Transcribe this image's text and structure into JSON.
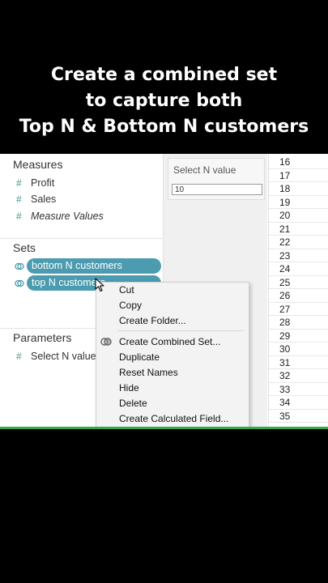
{
  "caption": {
    "line1": "Create a combined set",
    "line2": "to capture both",
    "line3": "Top N & Bottom N customers"
  },
  "data_pane": {
    "measures_title": "Measures",
    "measures": [
      "Profit",
      "Sales",
      "Measure Values"
    ],
    "sets_title": "Sets",
    "sets": [
      "bottom N customers",
      "top N customers"
    ],
    "parameters_title": "Parameters",
    "parameters": [
      "Select N value"
    ]
  },
  "filter_card": {
    "title": "Select N value",
    "value": "10"
  },
  "rows": [
    "16",
    "17",
    "18",
    "19",
    "20",
    "21",
    "22",
    "23",
    "24",
    "25",
    "26",
    "27",
    "28",
    "29",
    "30",
    "31",
    "32",
    "33",
    "34",
    "35"
  ],
  "context_menu": {
    "items": [
      "Cut",
      "Copy",
      "Create Folder...",
      "Create Combined Set...",
      "Duplicate",
      "Reset Names",
      "Hide",
      "Delete",
      "Create Calculated Field..."
    ]
  },
  "colors": {
    "set_pill": "#4b9cb0",
    "field_icon": "#3a9b8f",
    "window_border": "#2fa84f"
  }
}
